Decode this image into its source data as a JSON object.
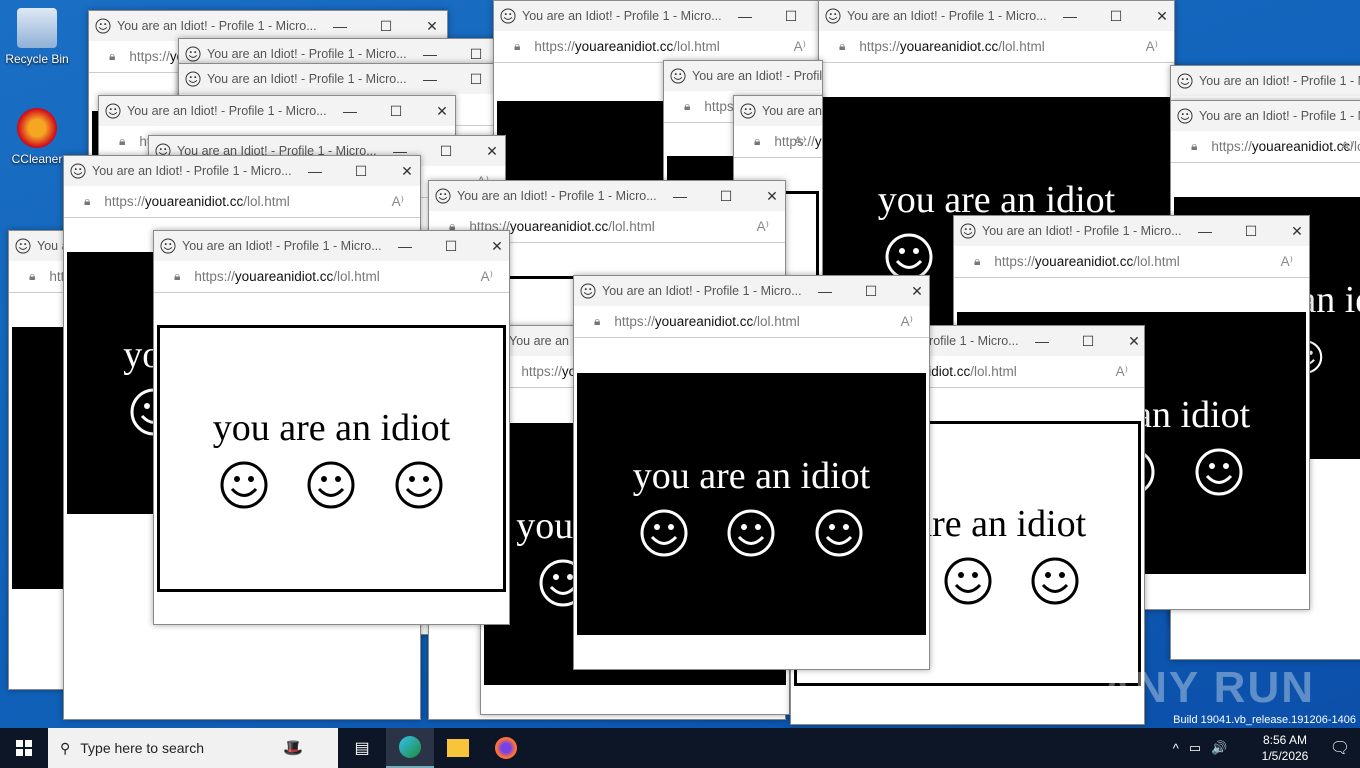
{
  "desktop": {
    "icons": [
      {
        "label": "Recycle Bin"
      },
      {
        "label": "CCleaner"
      }
    ]
  },
  "window": {
    "title": "You are an Idiot! - Profile 1 - Micro...",
    "url_prefix": "https://",
    "url_domain": "youareanidiot.cc",
    "url_path": "/lol.html",
    "page_text": "you are an idiot",
    "minimize": "—",
    "maximize": "☐",
    "close": "✕",
    "read_aloud": "A⁾"
  },
  "watermark": "ANY RUN",
  "build_text": "Build 19041.vb_release.191206-1406",
  "taskbar": {
    "search_placeholder": "Type here to search",
    "time": "8:56 AM",
    "date": "1/5/2026"
  }
}
